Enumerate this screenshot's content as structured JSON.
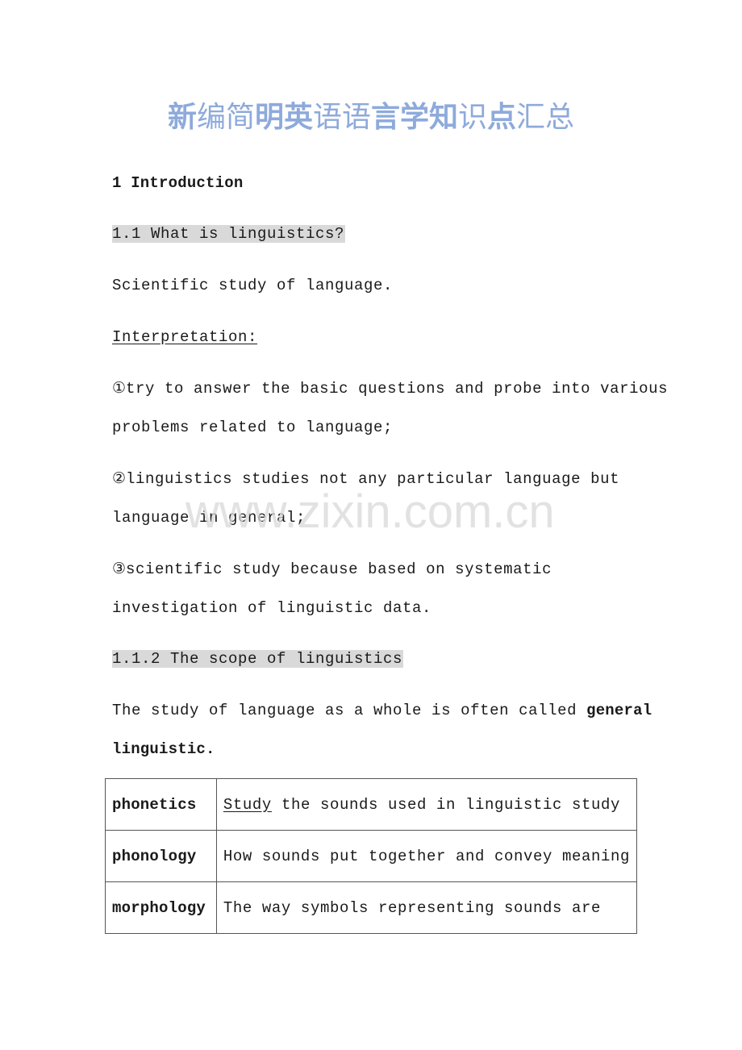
{
  "document": {
    "title_segments": [
      {
        "text": "新",
        "bold": true
      },
      {
        "text": "编简",
        "bold": false
      },
      {
        "text": "明英",
        "bold": true
      },
      {
        "text": "语语",
        "bold": false
      },
      {
        "text": "言学知",
        "bold": true
      },
      {
        "text": "识",
        "bold": false
      },
      {
        "text": "点",
        "bold": true
      },
      {
        "text": "汇总",
        "bold": false
      }
    ],
    "title_color": "#8eaadb",
    "highlight_color": "#d9d9d9",
    "section_heading": "1 Introduction",
    "subsection_1": "1.1 What is linguistics?",
    "definition": "Scientific study of language.",
    "interpretation_label": "Interpretation:",
    "points": [
      {
        "marker": "①",
        "line1": "try to answer the basic questions and probe into various",
        "line2": "problems related to language;"
      },
      {
        "marker": "②",
        "line1": "linguistics studies not any particular language but",
        "line2": "language in general;"
      },
      {
        "marker": "③",
        "line1": "scientific study because based on systematic",
        "line2": "investigation of linguistic data."
      }
    ],
    "subsection_2": "1.1.2 The scope of linguistics",
    "scope_intro_plain": "The study of language as a whole is often called ",
    "scope_intro_bold_1": "general",
    "scope_intro_bold_2": "linguistic.",
    "scope_table": [
      {
        "term": "phonetics",
        "desc_underlined": "Study",
        "desc_rest": " the sounds used in linguistic study"
      },
      {
        "term": "phonology",
        "desc_underlined": "",
        "desc_rest": "How sounds put together and convey meaning"
      },
      {
        "term": "morphology",
        "desc_underlined": "",
        "desc_rest": "The way symbols representing sounds are"
      }
    ]
  },
  "watermark": "www.zixin.com.cn"
}
